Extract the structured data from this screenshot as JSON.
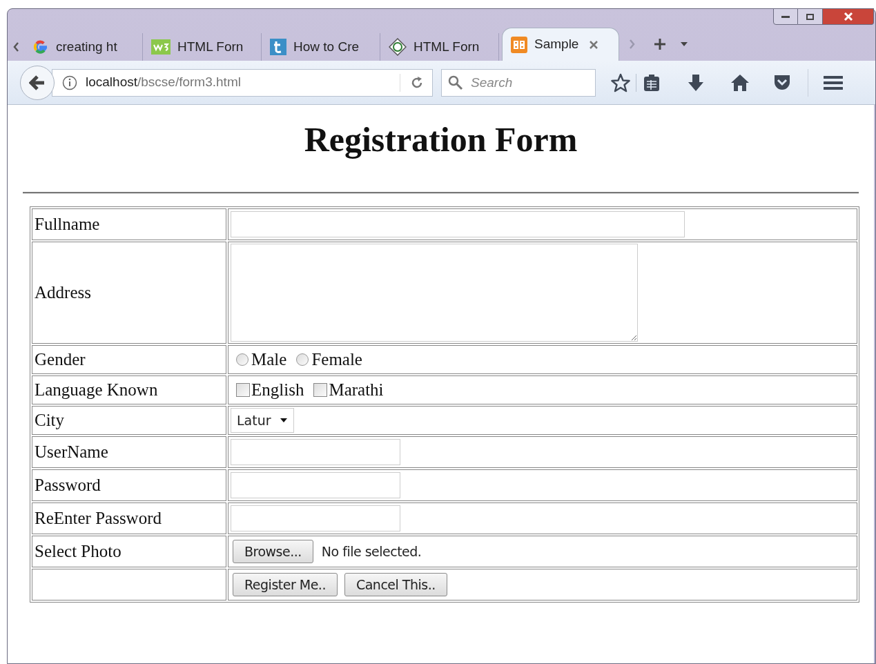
{
  "tabs": [
    {
      "title": "creating ht",
      "selected": false
    },
    {
      "title": "HTML Forn",
      "selected": false
    },
    {
      "title": "How to Cre",
      "selected": false
    },
    {
      "title": "HTML Forn",
      "selected": false
    },
    {
      "title": "Sample",
      "selected": true
    }
  ],
  "address": {
    "host": "localhost",
    "path": "/bscse/form3.html"
  },
  "search": {
    "placeholder": "Search"
  },
  "heading": "Registration Form",
  "rows": [
    {
      "label": "Fullname",
      "kind": "text"
    },
    {
      "label": "Address",
      "kind": "textarea"
    },
    {
      "label": "Gender",
      "kind": "radio",
      "options": [
        {
          "label": "Male",
          "selected": false
        },
        {
          "label": "Female",
          "selected": false
        }
      ]
    },
    {
      "label": "Language Known",
      "kind": "checkbox",
      "options": [
        {
          "label": "English",
          "checked": false
        },
        {
          "label": "Marathi",
          "checked": false
        }
      ]
    },
    {
      "label": "City",
      "kind": "select",
      "value": "Latur"
    },
    {
      "label": "UserName",
      "kind": "short"
    },
    {
      "label": "Password",
      "kind": "short"
    },
    {
      "label": "ReEnter Password",
      "kind": "short"
    },
    {
      "label": "Select Photo",
      "kind": "file",
      "button": "Browse...",
      "status": "No file selected."
    },
    {
      "kind": "buttons",
      "buttons": [
        "Register Me..",
        "Cancel This.."
      ]
    }
  ]
}
